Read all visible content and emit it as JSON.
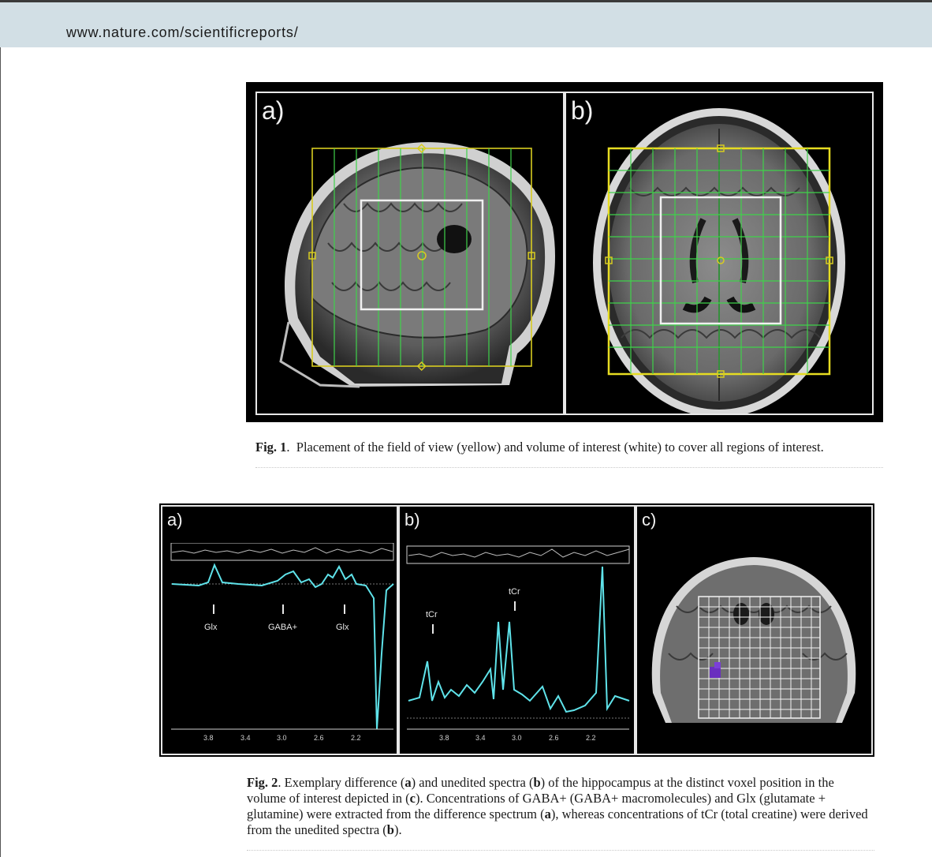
{
  "header": {
    "site_url": "www.nature.com/scientificreports/"
  },
  "figure1": {
    "panel_a_label": "a)",
    "panel_b_label": "b)",
    "caption_label": "Fig. 1",
    "caption_text": "Placement of the field of view (yellow) and volume of interest (white) to cover all regions of interest."
  },
  "figure2": {
    "panel_a_label": "a)",
    "panel_b_label": "b)",
    "panel_c_label": "c)",
    "panel_a_peaks": [
      "Glx",
      "GABA+",
      "Glx"
    ],
    "panel_b_peaks": [
      "tCr",
      "tCr"
    ],
    "ppm_ticks": [
      "3.8",
      "3.4",
      "3.0",
      "2.6",
      "2.2"
    ],
    "caption_label": "Fig. 2",
    "caption_parts": [
      {
        "t": ". Exemplary difference ("
      },
      {
        "b": "a"
      },
      {
        "t": ") and unedited spectra ("
      },
      {
        "b": "b"
      },
      {
        "t": ") of the hippocampus at the distinct voxel position in the volume of interest depicted in ("
      },
      {
        "b": "c"
      },
      {
        "t": "). Concentrations of GABA+ (GABA+ macromolecules) and Glx (glutamate + glutamine) were extracted from the difference spectrum ("
      },
      {
        "b": "a"
      },
      {
        "t": "), whereas concentrations of tCr (total creatine) were derived from the unedited spectra ("
      },
      {
        "b": "b"
      },
      {
        "t": ")."
      }
    ]
  },
  "colors": {
    "fov": "#d8cc20",
    "voi": "#f0f0f0",
    "grid": "#2ecc3a",
    "spectrum": "#5fe3ea"
  }
}
